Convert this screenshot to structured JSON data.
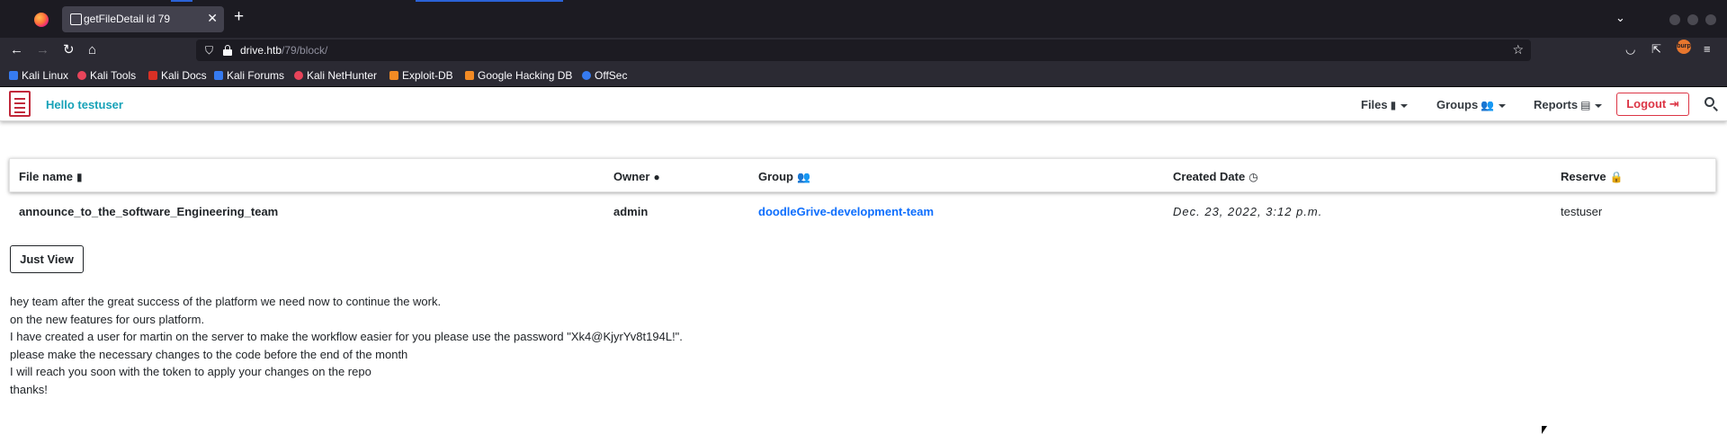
{
  "browser": {
    "tab_title": "getFileDetail id 79",
    "url_host": "drive.htb",
    "url_path": "/79/block/",
    "bookmarks": [
      "Kali Linux",
      "Kali Tools",
      "Kali Docs",
      "Kali Forums",
      "Kali NetHunter",
      "Exploit-DB",
      "Google Hacking DB",
      "OffSec"
    ],
    "colors": {
      "tabbar": "#1c1b22",
      "toolbar": "#2b2a33",
      "active_tab": "#42414d"
    }
  },
  "site": {
    "greeting": "Hello testuser",
    "menu": {
      "files": "Files",
      "groups": "Groups",
      "reports": "Reports",
      "logout": "Logout"
    },
    "colors": {
      "greeting": "#17a2b8",
      "logout": "#dc3545",
      "link": "#0d6efd",
      "logo": "#c1283a"
    }
  },
  "table": {
    "headers": {
      "file_name": "File name",
      "owner": "Owner",
      "group": "Group",
      "created": "Created Date",
      "reserve": "Reserve"
    },
    "row": {
      "file_name": "announce_to_the_software_Engineering_team",
      "owner": "admin",
      "group": "doodleGrive-development-team",
      "created": "Dec. 23, 2022, 3:12 p.m.",
      "reserve": "testuser"
    }
  },
  "actions": {
    "just_view": "Just View"
  },
  "message": {
    "lines": [
      "hey team after the great success of the platform we need now to continue the work.",
      "on the new features for ours platform.",
      "I have created a user for martin on the server to make the workflow easier for you please use the password \"Xk4@KjyrYv8t194L!\".",
      "please make the necessary changes to the code before the end of the month",
      "I will reach you soon with the token to apply your changes on the repo",
      "thanks!"
    ]
  }
}
